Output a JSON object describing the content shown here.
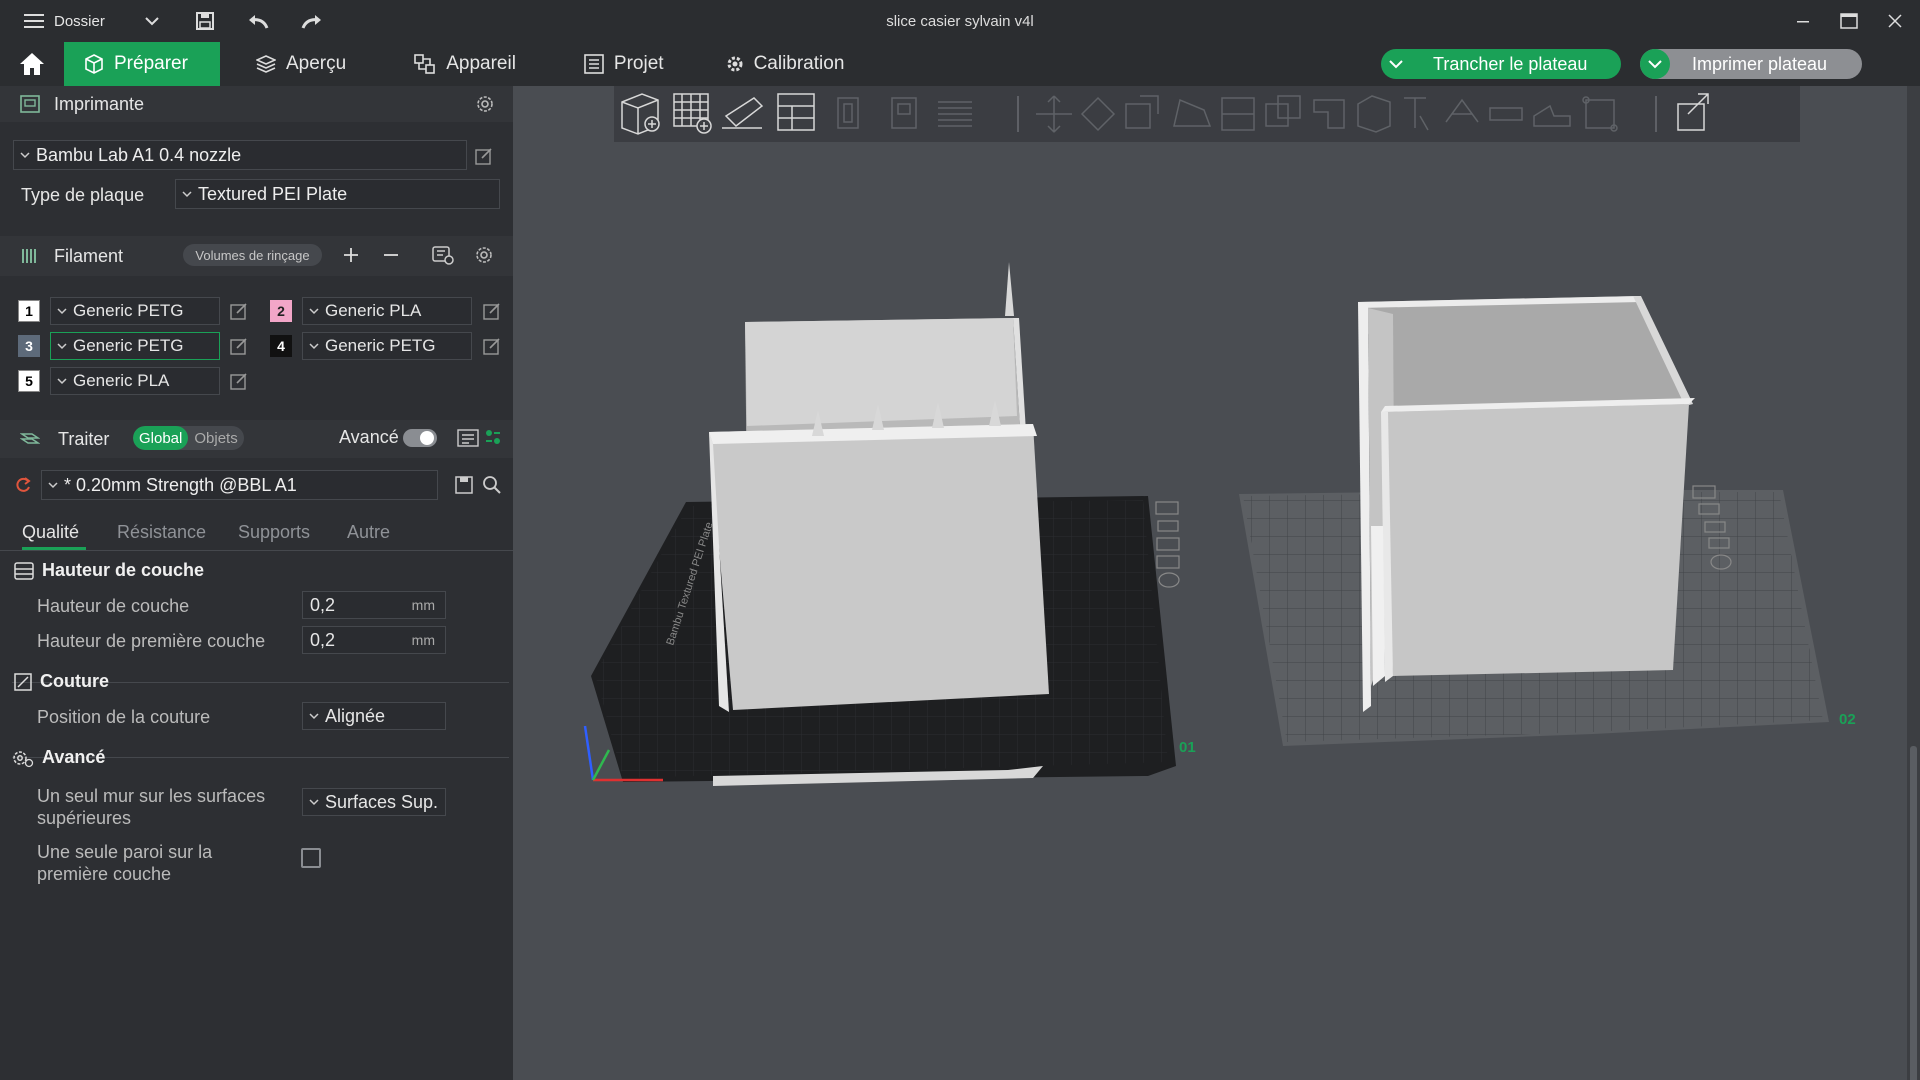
{
  "window": {
    "title": "slice casier sylvain v4l",
    "menu_label": "Dossier",
    "icons": [
      "menu-icon",
      "chevron-down-icon",
      "save-icon",
      "undo-icon",
      "redo-icon",
      "minimize-icon",
      "maximize-icon",
      "close-icon"
    ]
  },
  "tabs": {
    "home_icon": "home-icon",
    "items": [
      {
        "label": "Préparer",
        "icon": "cube-icon",
        "active": true
      },
      {
        "label": "Aperçu",
        "icon": "layers-icon"
      },
      {
        "label": "Appareil",
        "icon": "device-icon"
      },
      {
        "label": "Projet",
        "icon": "project-icon"
      },
      {
        "label": "Calibration",
        "icon": "calibration-icon"
      }
    ],
    "slice_button": "Trancher le plateau",
    "print_button": "Imprimer plateau"
  },
  "printer": {
    "section_label": "Imprimante",
    "printer_name": "Bambu Lab A1 0.4 nozzle",
    "plate_type_label": "Type de plaque",
    "plate_type_value": "Textured PEI Plate"
  },
  "filament": {
    "section_label": "Filament",
    "flush_button": "Volumes de rinçage",
    "slots": [
      {
        "num": "1",
        "name": "Generic PETG",
        "color": "#ffffff"
      },
      {
        "num": "2",
        "name": "Generic PLA",
        "color": "#f2a6c8"
      },
      {
        "num": "3",
        "name": "Generic PETG",
        "color": "#5d6a7a"
      },
      {
        "num": "4",
        "name": "Generic PETG",
        "color": "#111111"
      },
      {
        "num": "5",
        "name": "Generic PLA",
        "color": "#ffffff"
      }
    ]
  },
  "process": {
    "section_label": "Traiter",
    "seg_global": "Global",
    "seg_objects": "Objets",
    "advanced_label": "Avancé",
    "advanced_on": false,
    "preset": "* 0.20mm Strength @BBL A1",
    "subtabs": [
      "Qualité",
      "Résistance",
      "Supports",
      "Autre"
    ],
    "active_subtab": "Qualité",
    "groups": {
      "layer_height": {
        "title": "Hauteur de couche",
        "layer_height_label": "Hauteur de couche",
        "layer_height_value": "0,2",
        "first_layer_label": "Hauteur de première couche",
        "first_layer_value": "0,2",
        "unit": "mm"
      },
      "seam": {
        "title": "Couture",
        "position_label": "Position de la couture",
        "position_value": "Alignée"
      },
      "advanced": {
        "title": "Avancé",
        "top_wall_label_1": "Un seul mur sur les surfaces",
        "top_wall_label_2": "supérieures",
        "top_wall_value": "Surfaces Sup.",
        "first_layer_wall_label_1": "Une seule paroi sur la",
        "first_layer_wall_label_2": "première couche",
        "first_layer_wall_checked": false
      }
    }
  },
  "viewport": {
    "plate1_label": "01",
    "plate2_label": "02",
    "plate_brand_text": "Bambu Textured PEI Plate"
  },
  "colors": {
    "accent": "#1aa157",
    "panel_bg": "#2d2f33",
    "viewport_bg": "#4a4d52"
  }
}
